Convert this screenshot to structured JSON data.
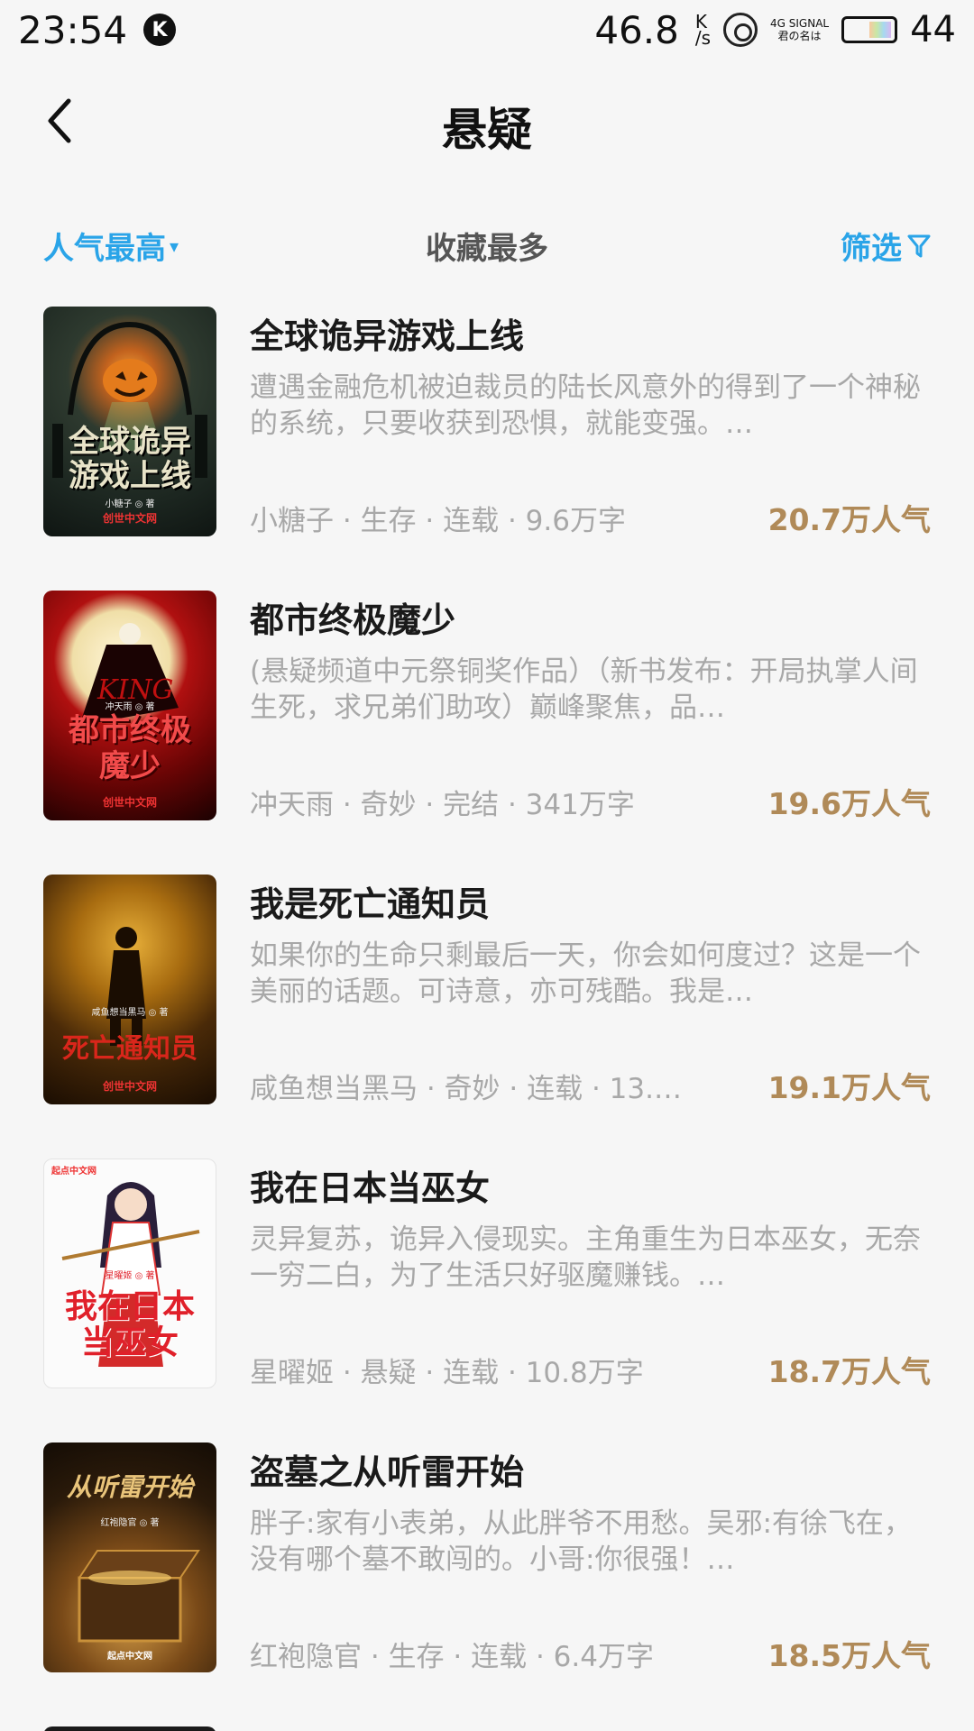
{
  "status_bar": {
    "time": "23:54",
    "app_badge": "K",
    "net_speed": "46.8",
    "net_unit_top": "K",
    "net_unit_bottom": "/s",
    "signal_top": "4G SIGNAL",
    "signal_bottom": "君の名は",
    "battery": "44"
  },
  "header": {
    "title": "悬疑",
    "back_icon": "chevron-left-icon"
  },
  "sort_bar": {
    "hot": "人气最高",
    "hot_caret": "▾",
    "favorites": "收藏最多",
    "filter": "筛选",
    "accent_color": "#2aa4e8"
  },
  "books": [
    {
      "title": "全球诡异游戏上线",
      "description": "遭遇金融危机被迫裁员的陆长风意外的得到了一个神秘的系统，只要收获到恐惧，就能变强。…",
      "meta": "小糖子 · 生存 · 连载 · 9.6万字",
      "popularity": "20.7万人气",
      "cover_text": "全球诡异游戏上线",
      "cover_author": "小糖子 ◎ 著",
      "cover_pub": "创世中文网"
    },
    {
      "title": "都市终极魔少",
      "description": "(悬疑频道中元祭铜奖作品）（新书发布：开局执掌人间生死，求兄弟们助攻）巅峰聚焦，品…",
      "meta": "冲天雨 · 奇妙 · 完结 · 341万字",
      "popularity": "19.6万人气",
      "cover_text": "都市终极魔少",
      "cover_author": "冲天雨 ◎ 著",
      "cover_pub": "创世中文网"
    },
    {
      "title": "我是死亡通知员",
      "description": "如果你的生命只剩最后一天，你会如何度过？这是一个美丽的话题。可诗意，亦可残酷。我是…",
      "meta": "咸鱼想当黑马 · 奇妙 · 连载 · 13.…",
      "popularity": "19.1万人气",
      "cover_text": "死亡通知员",
      "cover_author": "咸鱼想当黑马 ◎ 著",
      "cover_pub": "创世中文网"
    },
    {
      "title": "我在日本当巫女",
      "description": "灵异复苏，诡异入侵现实。主角重生为日本巫女，无奈一穷二白，为了生活只好驱魔赚钱。…",
      "meta": "星曜姬 · 悬疑 · 连载 · 10.8万字",
      "popularity": "18.7万人气",
      "cover_text": "我在日本当巫女",
      "cover_author": "星曜姬 ◎ 著",
      "cover_pub": "起点中文网"
    },
    {
      "title": "盗墓之从听雷开始",
      "description": "胖子:家有小表弟，从此胖爷不用愁。吴邪:有徐飞在，没有哪个墓不敢闯的。小哥:你很强！…",
      "meta": "红袍隐官 · 生存 · 连载 · 6.4万字",
      "popularity": "18.5万人气",
      "cover_text": "从听雷开始",
      "cover_author": "红袍隐官 ◎ 著",
      "cover_pub": "起点中文网"
    }
  ]
}
